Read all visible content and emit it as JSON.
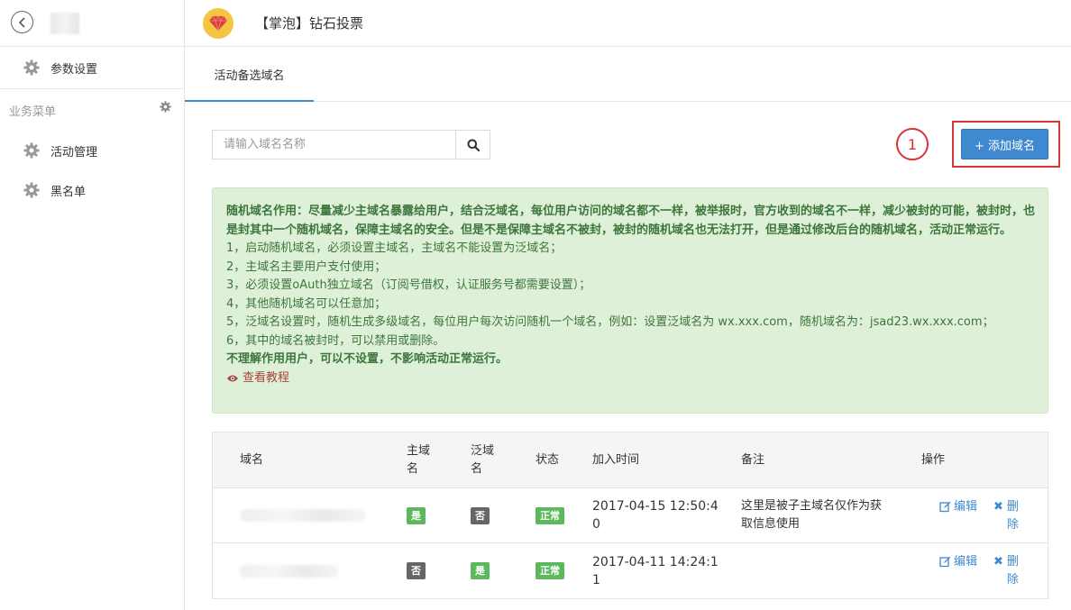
{
  "sidebar": {
    "back_icon": "chevron-left-icon",
    "settings_label": "参数设置",
    "section_title": "业务菜单",
    "items": [
      {
        "label": "活动管理",
        "icon": "gear-icon"
      },
      {
        "label": "黑名单",
        "icon": "gear-icon"
      }
    ]
  },
  "header": {
    "title": "【掌泡】钻石投票",
    "icon": "diamond-icon"
  },
  "tabs": [
    {
      "label": "活动备选域名"
    }
  ],
  "search": {
    "placeholder": "请输入域名名称",
    "value": ""
  },
  "step_marker": "1",
  "add_button_label": "+ 添加域名",
  "notice": {
    "bold_intro": "随机域名作用：尽量减少主域名暴露给用户，结合泛域名，每位用户访问的域名都不一样，被举报时，官方收到的域名不一样，减少被封的可能，被封时，也是封其中一个随机域名，保障主域名的安全。但是不是保障主域名不被封，被封的随机域名也无法打开，但是通过修改后台的随机域名，活动正常运行。",
    "lines": [
      "1，启动随机域名，必须设置主域名，主域名不能设置为泛域名；",
      "2，主域名主要用户支付使用；",
      "3，必须设置oAuth独立域名（订阅号借权，认证服务号都需要设置）；",
      "4，其他随机域名可以任意加；",
      "5，泛域名设置时，随机生成多级域名，每位用户每次访问随机一个域名，例如：设置泛域名为 wx.xxx.com，随机域名为：jsad23.wx.xxx.com；",
      "6，其中的域名被封时，可以禁用或删除。"
    ],
    "bold_outro": "不理解作用用户，可以不设置，不影响活动正常运行。",
    "tutorial_label": "查看教程"
  },
  "table": {
    "headers": {
      "domain": "域名",
      "main_1": "主域",
      "main_2": "名",
      "wild_1": "泛域",
      "wild_2": "名",
      "status": "状态",
      "time": "加入时间",
      "note": "备注",
      "ops": "操作"
    },
    "rows": [
      {
        "is_main": "是",
        "is_main_color": "#5cb85c",
        "is_wild": "否",
        "is_wild_color": "#666666",
        "status": "正常",
        "time_1": "2017-04-15 12:50:4",
        "time_2": "0",
        "note_1": "这里是被子主域名仅作为获",
        "note_2": "取信息使用",
        "edit_label": "编辑",
        "del_1": "删",
        "del_2": "除"
      },
      {
        "is_main": "否",
        "is_main_color": "#666666",
        "is_wild": "是",
        "is_wild_color": "#5cb85c",
        "status": "正常",
        "time_1": "2017-04-11 14:24:1",
        "time_2": "1",
        "note_1": "",
        "note_2": "",
        "edit_label": "编辑",
        "del_1": "删",
        "del_2": "除"
      }
    ]
  }
}
